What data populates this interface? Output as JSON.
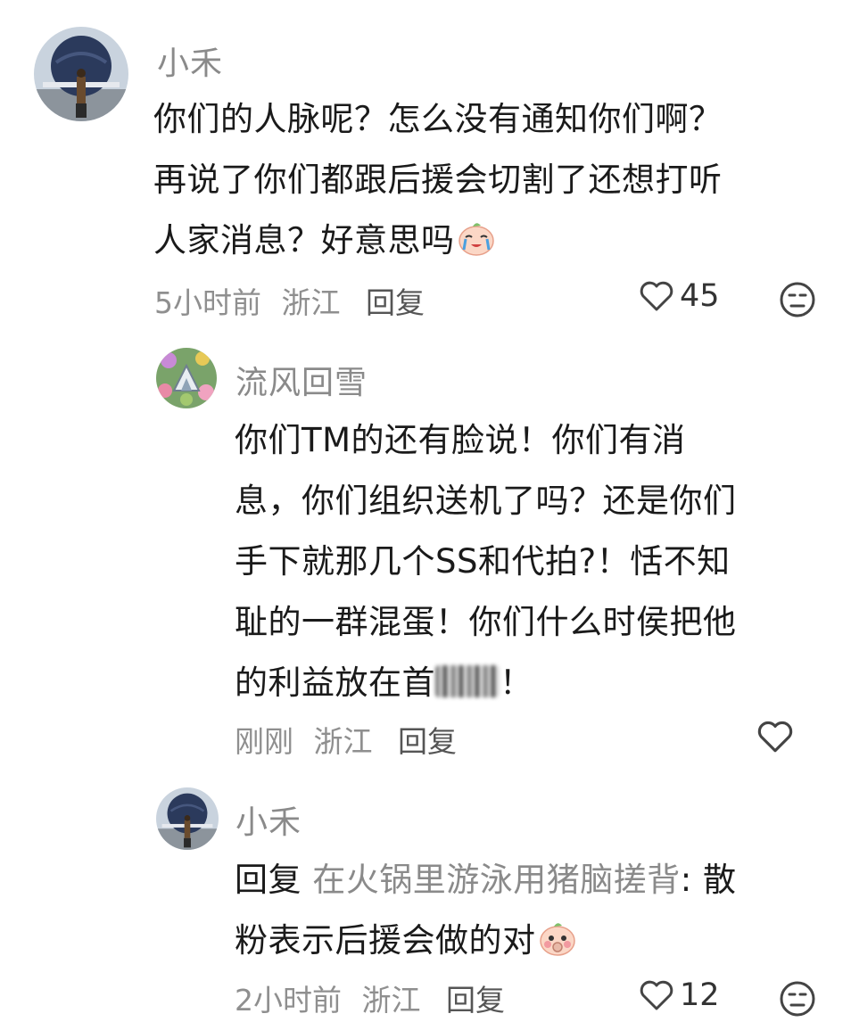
{
  "comments": [
    {
      "user": "小禾",
      "text_lines": [
        "你们的人脉呢？怎么没有通知你们啊？",
        "再说了你们都跟后援会切割了还想打听",
        "人家消息？好意思吗"
      ],
      "time": "5小时前",
      "location": "浙江",
      "reply_label": "回复",
      "likes": "45"
    },
    {
      "user": "流风回雪",
      "text_lines": [
        "你们TM的还有脸说！你们有消",
        "息，你们组织送机了吗？还是你们",
        "手下就那几个SS和代拍?！恬不知",
        "耻的一群混蛋！你们什么时侯把他",
        "的利益放在首",
        "！"
      ],
      "time": "刚刚",
      "location": "浙江",
      "reply_label": "回复"
    },
    {
      "user": "小禾",
      "reply_prefix": "回复",
      "reply_target": "在火锅里游泳用猪脑搓背",
      "reply_colon": ":",
      "text_lines": [
        "散",
        "粉表示后援会做的对"
      ],
      "time": "2小时前",
      "location": "浙江",
      "reply_label": "回复",
      "likes": "12"
    }
  ],
  "icons": [
    "heart-outline-icon",
    "dislike-face-icon",
    "crying-emoji-icon",
    "shy-emoji-icon"
  ]
}
